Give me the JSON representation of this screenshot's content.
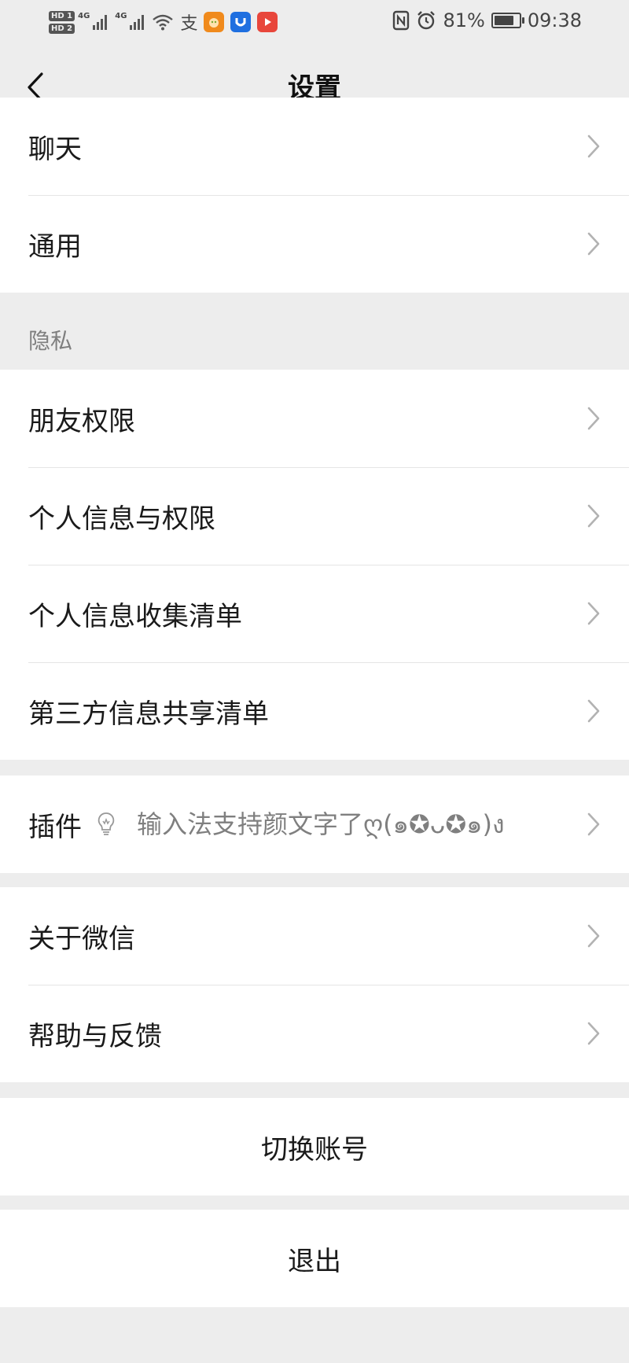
{
  "status_bar": {
    "hd_top": "HD 1",
    "hd_bottom": "HD 2",
    "net1": "4G",
    "net2": "4G",
    "alipay_glyph": "支",
    "battery_percent": "81%",
    "battery_level": 0.81,
    "time": "09:38"
  },
  "nav": {
    "title": "设置"
  },
  "group_top": {
    "items": [
      {
        "label": "聊天"
      },
      {
        "label": "通用"
      }
    ]
  },
  "privacy": {
    "header": "隐私",
    "items": [
      {
        "label": "朋友权限"
      },
      {
        "label": "个人信息与权限"
      },
      {
        "label": "个人信息收集清单"
      },
      {
        "label": "第三方信息共享清单"
      }
    ]
  },
  "plugins": {
    "label": "插件",
    "description": "输入法支持颜文字了ღ(๑✪ᴗ✪๑)ง"
  },
  "about": {
    "items": [
      {
        "label": "关于微信"
      },
      {
        "label": "帮助与反馈"
      }
    ]
  },
  "switch_account": {
    "label": "切换账号"
  },
  "logout": {
    "label": "退出"
  },
  "icons": {
    "back": "chevron-left-icon",
    "row_arrow": "chevron-right-icon",
    "plugin": "lightbulb-icon"
  },
  "colors": {
    "background": "#ededed",
    "cell": "#ffffff",
    "secondary_text": "#7f7f7f",
    "chevron": "#b2b2b2"
  }
}
